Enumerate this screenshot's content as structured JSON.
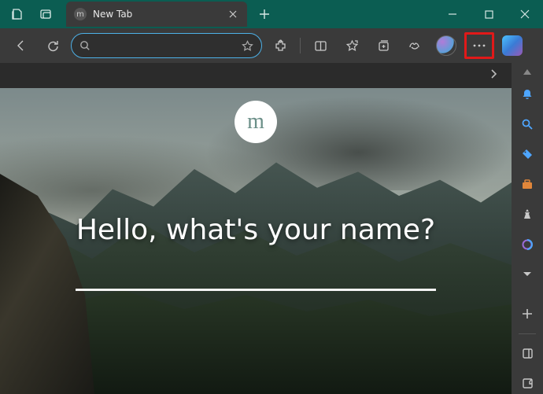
{
  "window": {
    "tab_title": "New Tab"
  },
  "toolbar": {
    "address_value": "",
    "address_placeholder": ""
  },
  "ntp": {
    "brand_letter": "m",
    "greeting": "Hello, what's your name?",
    "name_value": ""
  },
  "sidebar": {
    "items": [
      {
        "name": "bell"
      },
      {
        "name": "search"
      },
      {
        "name": "tag"
      },
      {
        "name": "briefcase"
      },
      {
        "name": "chess"
      },
      {
        "name": "loop"
      }
    ]
  }
}
